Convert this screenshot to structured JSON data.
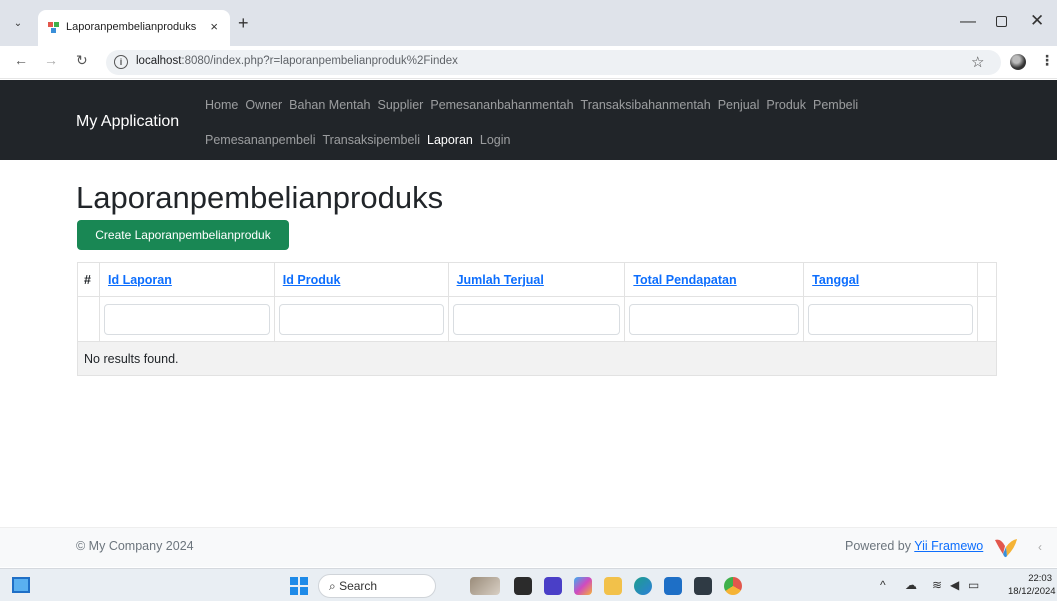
{
  "browser": {
    "tab_title": "Laporanpembelianproduks",
    "tab_close": "×",
    "new_tab": "+",
    "url_host": "localhost",
    "url_rest": ":8080/index.php?r=laporanpembelianproduk%2Findex",
    "window_min": "—",
    "window_close": "✕"
  },
  "navbar": {
    "brand": "My Application",
    "row1": [
      "Home",
      "Owner",
      "Bahan Mentah",
      "Supplier",
      "Pemesananbahanmentah",
      "Transaksibahanmentah",
      "Penjual",
      "Produk",
      "Pembeli"
    ],
    "row2": [
      "Pemesananpembeli",
      "Transaksipembeli",
      "Laporan",
      "Login"
    ],
    "active": "Laporan"
  },
  "page": {
    "title": "Laporanpembelianproduks",
    "create_button": "Create Laporanpembelianproduk"
  },
  "grid": {
    "columns": [
      "#",
      "Id Laporan",
      "Id Produk",
      "Jumlah Terjual",
      "Total Pendapatan",
      "Tanggal"
    ],
    "empty_text": "No results found."
  },
  "footer": {
    "copyright": "© My Company 2024",
    "powered_prefix": "Powered by ",
    "powered_link": "Yii Framewo"
  },
  "taskbar": {
    "search_label": "Search",
    "time": "22:03",
    "date": "18/12/2024"
  },
  "colors": {
    "navbar_bg": "#212529",
    "create_button_bg": "#198754",
    "link": "#0d6efd"
  }
}
